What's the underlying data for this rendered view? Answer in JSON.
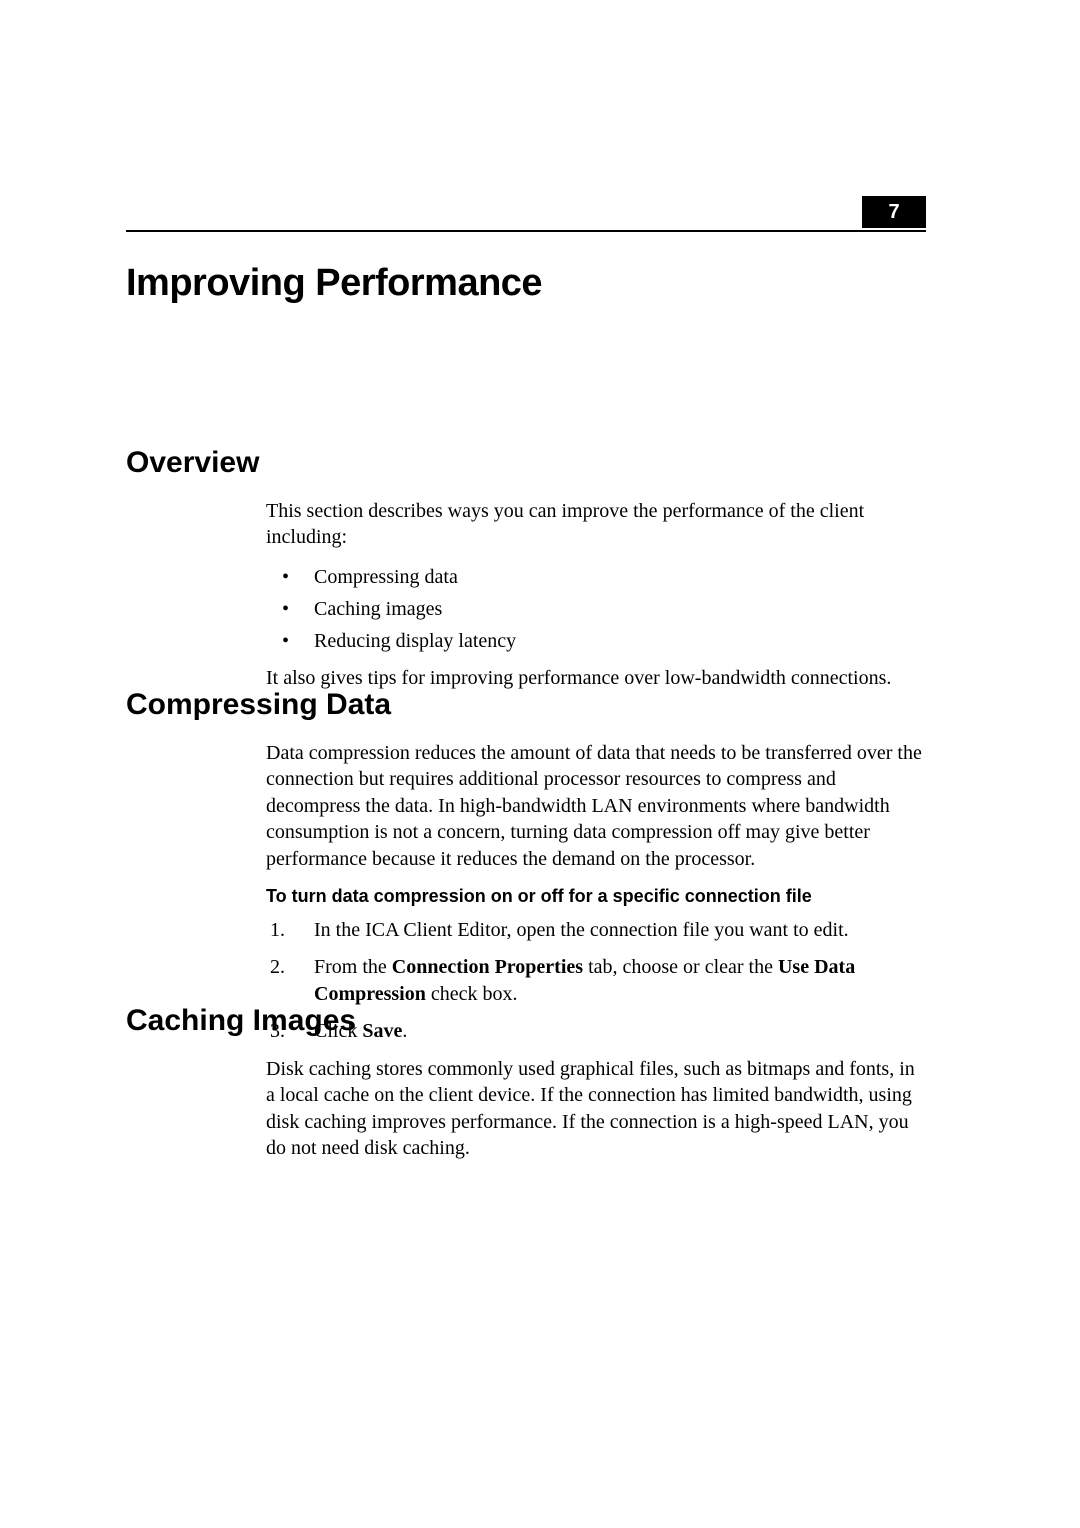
{
  "chapter_number": "7",
  "title": "Improving Performance",
  "overview": {
    "heading": "Overview",
    "intro": "This section describes ways you can improve the performance of the client including:",
    "bullets": [
      "Compressing data",
      "Caching images",
      "Reducing display latency"
    ],
    "outro": "It also gives tips for improving performance over low-bandwidth connections."
  },
  "compressing": {
    "heading": "Compressing Data",
    "para": "Data compression reduces the amount of data that needs to be transferred over the connection but requires additional processor resources to compress and decompress the data. In high-bandwidth LAN environments where bandwidth consumption is not a concern, turning data compression off may give better performance because it reduces the demand on the processor.",
    "subhead": "To turn data compression on or off for a specific connection file",
    "steps_plain": [
      "In the ICA Client Editor, open the connection file you want to edit.",
      "From the Connection Properties tab, choose or clear the Use Data Compression check box.",
      "Click Save."
    ],
    "step2_pre": "From the ",
    "step2_b1": "Connection Properties",
    "step2_mid": " tab, choose or clear the ",
    "step2_b2": "Use Data Compression",
    "step2_post": " check box.",
    "step3_pre": "Click ",
    "step3_b": "Save",
    "step3_post": "."
  },
  "caching": {
    "heading": "Caching Images",
    "para": "Disk caching stores commonly used graphical files, such as bitmaps and fonts, in a local cache on the client device. If the connection has limited bandwidth, using disk caching improves performance. If the connection is a high-speed LAN, you do not need disk caching."
  }
}
